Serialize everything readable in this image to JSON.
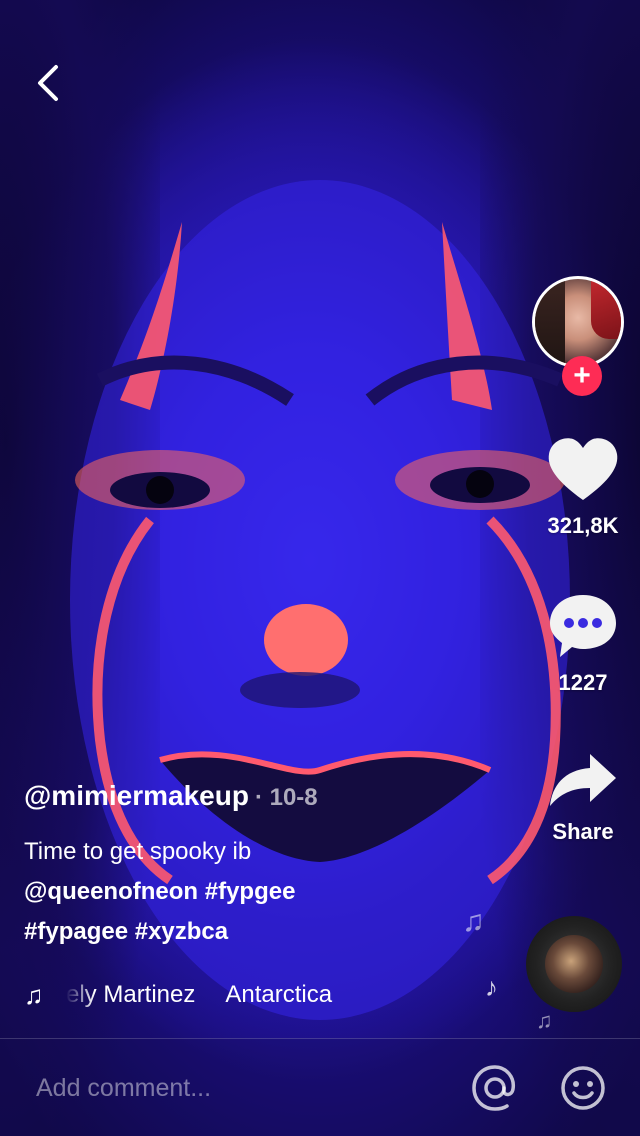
{
  "video": {
    "author": "@mimiermakeup",
    "date": "· 10-8",
    "description": {
      "text": "Time to get spooky ib",
      "mention": "@queenofneon",
      "tags_line1": "#fypgee",
      "tags_line2": "#fypagee #xyzbca"
    },
    "music": {
      "title_fragment": "ely Martinez",
      "title_next": "Antarctica"
    }
  },
  "actions": {
    "like_count": "321,8K",
    "comment_count": "1227",
    "share_label": "Share",
    "follow_symbol": "+"
  },
  "comment_bar": {
    "placeholder": "Add comment..."
  },
  "colors": {
    "background": "#2f1fd8",
    "accent": "#fe2c55",
    "text": "#ffffff"
  },
  "icons": [
    "back-icon",
    "heart-icon",
    "comment-bubble-icon",
    "share-arrow-icon",
    "music-note-icon",
    "at-icon",
    "emoji-icon"
  ]
}
